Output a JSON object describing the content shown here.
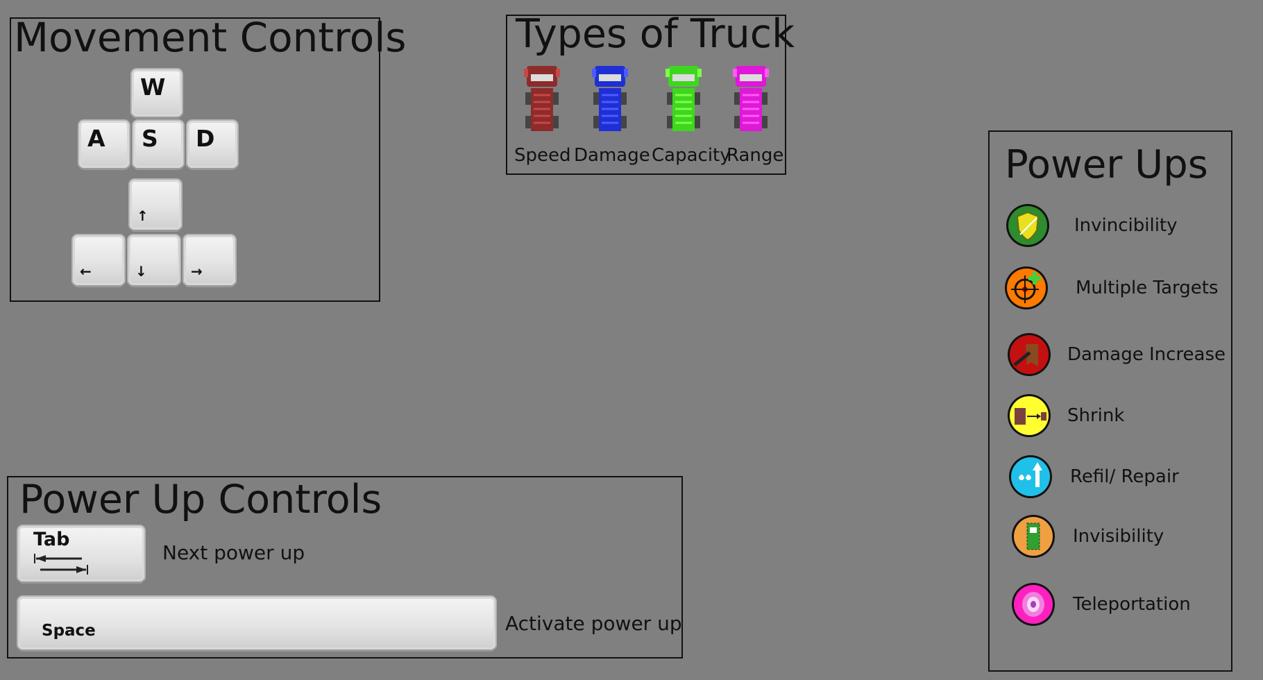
{
  "movement": {
    "title": "Movement Controls",
    "keys": {
      "w": "W",
      "a": "A",
      "s": "S",
      "d": "D"
    },
    "arrows": {
      "up": "↑",
      "left": "←",
      "down": "↓",
      "right": "→"
    }
  },
  "trucks": {
    "title": "Types of Truck",
    "items": [
      {
        "label": "Speed",
        "color": "#8e2b2b",
        "accent": "#c94646"
      },
      {
        "label": "Damage",
        "color": "#1f2fd6",
        "accent": "#4a5cff"
      },
      {
        "label": "Capacity",
        "color": "#3fd61f",
        "accent": "#7cff4a"
      },
      {
        "label": "Range",
        "color": "#e018d8",
        "accent": "#ff5cf2"
      }
    ]
  },
  "powerups": {
    "title": "Power Ups",
    "items": [
      {
        "label": "Invincibility",
        "icon": "shield-icon",
        "color": "#2e8b2e"
      },
      {
        "label": "Multiple Targets",
        "icon": "crosshair-icon",
        "color": "#ff7a00"
      },
      {
        "label": "Damage Increase",
        "icon": "damage-icon",
        "color": "#c41010"
      },
      {
        "label": "Shrink",
        "icon": "shrink-icon",
        "color": "#ffff30"
      },
      {
        "label": "Refil/ Repair",
        "icon": "refill-icon",
        "color": "#20c0e8"
      },
      {
        "label": "Invisibility",
        "icon": "invisibility-icon",
        "color": "#f0a040"
      },
      {
        "label": "Teleportation",
        "icon": "teleport-icon",
        "color": "#ff20c0"
      }
    ]
  },
  "powerup_controls": {
    "title": "Power Up Controls",
    "tab_key": "Tab",
    "tab_desc": "Next power up",
    "space_key": "Space",
    "space_desc": "Activate power up"
  }
}
